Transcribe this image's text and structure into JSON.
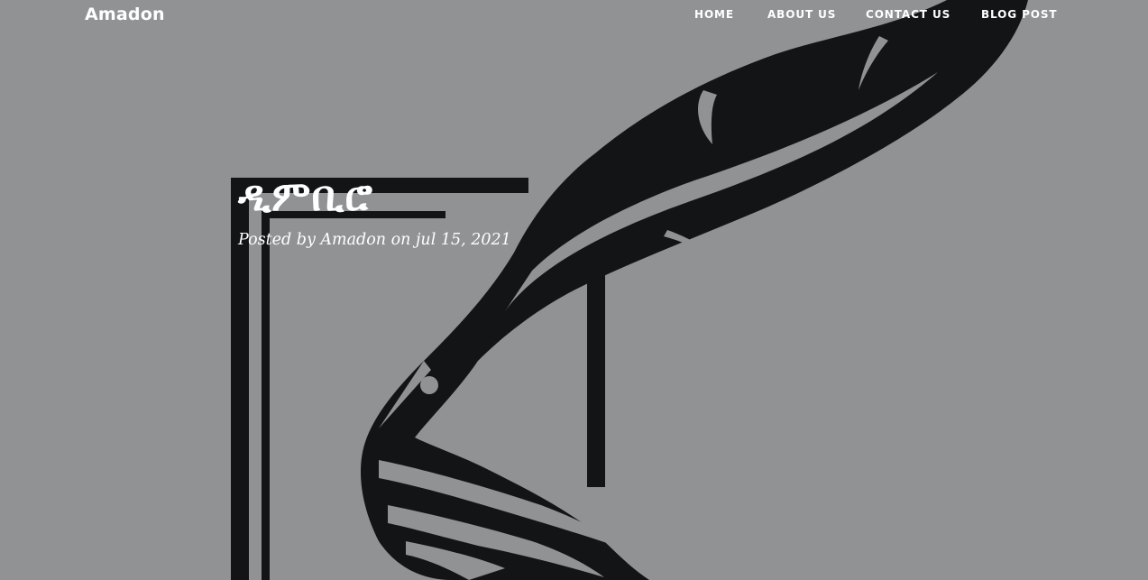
{
  "nav": {
    "brand": "Amadon",
    "links": [
      {
        "label": "HOME"
      },
      {
        "label": "ABOUT US"
      },
      {
        "label": "CONTACT US"
      },
      {
        "label": "BLOG POST"
      }
    ]
  },
  "post": {
    "title": "ዲምቢሮ",
    "meta": "Posted by Amadon on jul 15, 2021"
  },
  "colors": {
    "background": "#919294",
    "illustration": "#131416",
    "text": "#ffffff"
  },
  "illustration": {
    "icon": "quill-pen-over-frame"
  }
}
